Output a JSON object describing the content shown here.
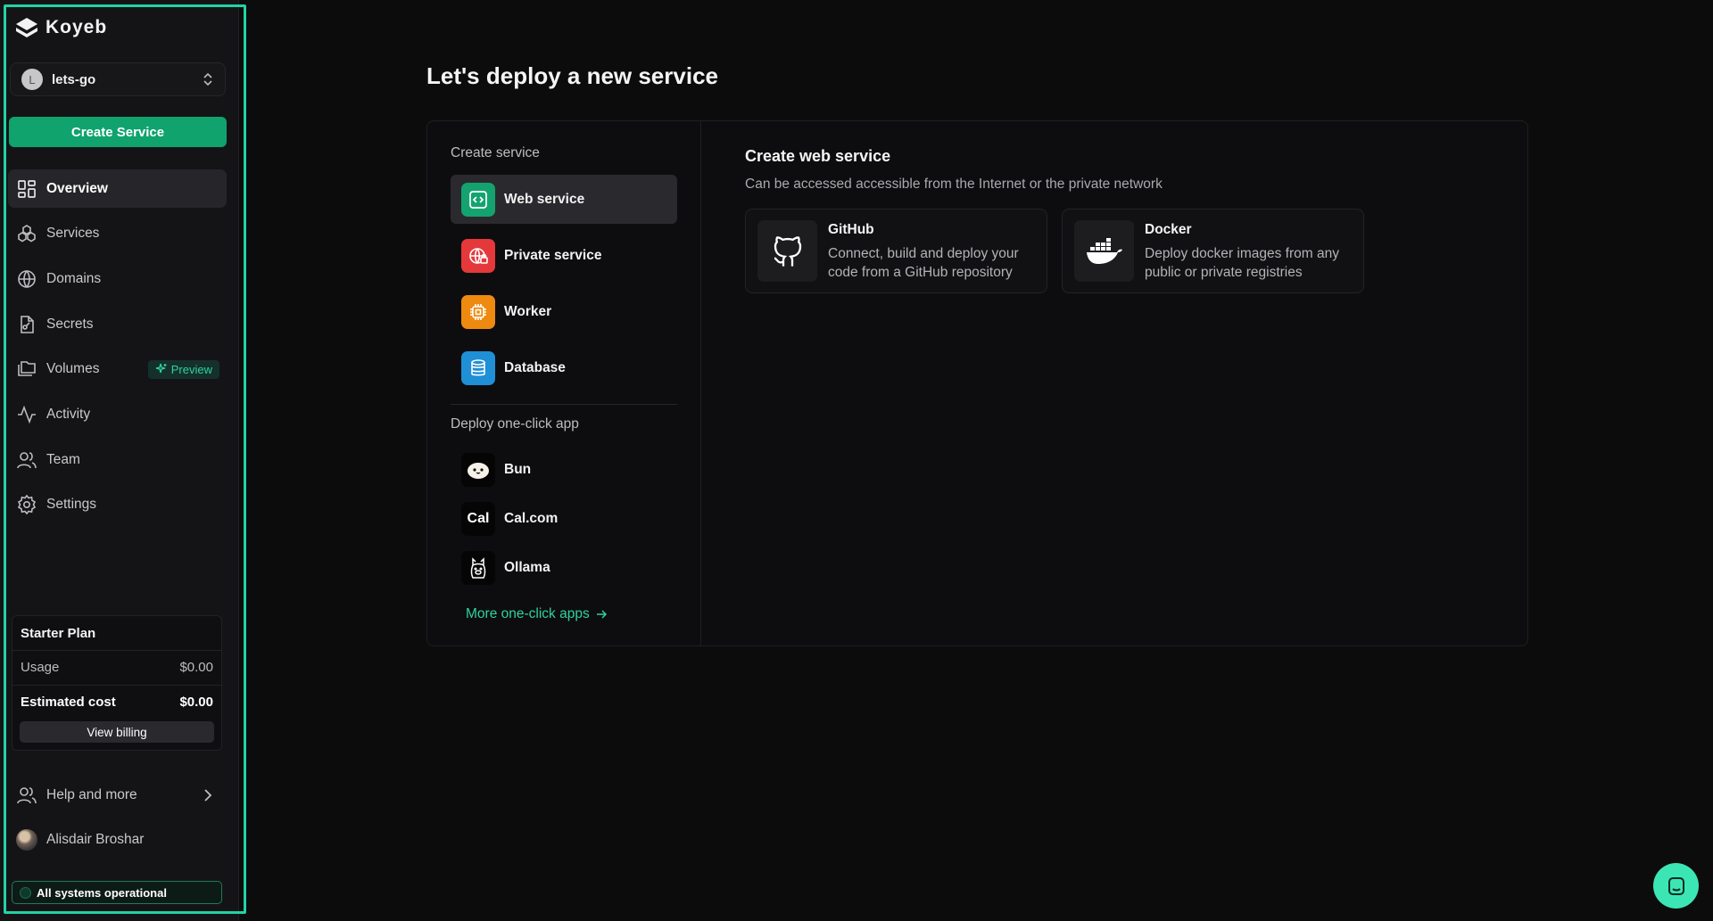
{
  "brand": {
    "name": "Koyeb"
  },
  "org": {
    "initial": "L",
    "name": "lets-go"
  },
  "sidebar": {
    "create_label": "Create Service",
    "items": [
      {
        "label": "Overview",
        "icon": "grid-icon"
      },
      {
        "label": "Services",
        "icon": "services-icon"
      },
      {
        "label": "Domains",
        "icon": "globe-icon"
      },
      {
        "label": "Secrets",
        "icon": "secret-file-icon"
      },
      {
        "label": "Volumes",
        "icon": "volumes-icon",
        "badge": "Preview"
      },
      {
        "label": "Activity",
        "icon": "activity-icon"
      },
      {
        "label": "Team",
        "icon": "team-icon"
      },
      {
        "label": "Settings",
        "icon": "gear-icon"
      }
    ],
    "active_item": "Overview",
    "plan": {
      "title": "Starter Plan",
      "usage_label": "Usage",
      "usage_value": "$0.00",
      "cost_label": "Estimated cost",
      "cost_value": "$0.00",
      "billing_label": "View billing"
    },
    "help_label": "Help and more",
    "user_name": "Alisdair Broshar",
    "status_text": "All systems operational"
  },
  "main": {
    "title": "Let's deploy a new service",
    "create_service_label": "Create service",
    "service_types": [
      {
        "label": "Web service",
        "icon": "web-service-icon",
        "color": "#14a36f"
      },
      {
        "label": "Private service",
        "icon": "private-service-icon",
        "color": "#e5383b"
      },
      {
        "label": "Worker",
        "icon": "worker-icon",
        "color": "#ee8a10"
      },
      {
        "label": "Database",
        "icon": "database-icon",
        "color": "#1f8fd6"
      }
    ],
    "deploy_label": "Deploy one-click app",
    "apps": [
      {
        "label": "Bun",
        "icon": "bun-icon"
      },
      {
        "label": "Cal.com",
        "icon": "calcom-icon",
        "icon_text": "Cal"
      },
      {
        "label": "Ollama",
        "icon": "ollama-icon"
      }
    ],
    "more_apps_label": "More one-click apps",
    "right": {
      "title": "Create web service",
      "subtitle": "Can be accessed accessible from the Internet or the private network",
      "sources": [
        {
          "title": "GitHub",
          "desc": "Connect, build and deploy your code from a GitHub repository",
          "icon": "github-icon"
        },
        {
          "title": "Docker",
          "desc": "Deploy docker images from any public or private registries",
          "icon": "docker-icon"
        }
      ]
    }
  },
  "colors": {
    "accent": "#10a36e",
    "link": "#2fd39c",
    "frame": "#22d3a5",
    "chat": "#3ce6b4"
  }
}
